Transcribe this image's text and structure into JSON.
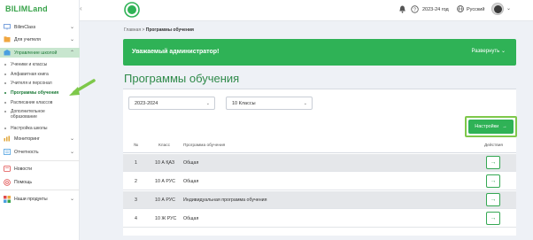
{
  "logo": "BILIMLand",
  "sidebar": {
    "items": [
      {
        "label": "BilimClass",
        "icon": "monitor-icon"
      },
      {
        "label": "Для учителя",
        "icon": "folder-icon"
      },
      {
        "label": "Управление школой",
        "icon": "school-icon"
      }
    ],
    "subitems": [
      {
        "label": "Ученики и классы"
      },
      {
        "label": "Алфавитная книга"
      },
      {
        "label": "Учителя и персонал"
      },
      {
        "label": "Программы обучения"
      },
      {
        "label": "Расписание классов"
      },
      {
        "label": "Дополнительное образование"
      },
      {
        "label": "Настройка школы"
      }
    ],
    "bottom_items": [
      {
        "label": "Мониторинг",
        "icon": "chart-icon"
      },
      {
        "label": "Отчетность",
        "icon": "report-icon"
      },
      {
        "label": "Новости",
        "icon": "news-icon"
      },
      {
        "label": "Помощь",
        "icon": "help-icon"
      },
      {
        "label": "Наши продукты",
        "icon": "products-icon"
      }
    ]
  },
  "topbar": {
    "year": "2023-24 год",
    "language": "Русский"
  },
  "breadcrumb": {
    "home": "Главная",
    "separator": ">",
    "current": "Программы обучения"
  },
  "banner": {
    "text": "Уважаемый администратор!",
    "expand_label": "Развернуть"
  },
  "page_title": "Программы обучения",
  "filters": {
    "year_value": "2023-2024",
    "class_value": "10 Классы"
  },
  "settings_button": "Настройки",
  "table": {
    "headers": {
      "num": "№",
      "class": "Класс",
      "program": "Программа обучения",
      "actions": "Действия"
    },
    "rows": [
      {
        "num": "1",
        "class": "10 А ҚАЗ",
        "program": "Общая"
      },
      {
        "num": "2",
        "class": "10 А РУС",
        "program": "Общая"
      },
      {
        "num": "3",
        "class": "10 А РУС",
        "program": "Индивидуальная программа обучения"
      },
      {
        "num": "4",
        "class": "10 Ж РУС",
        "program": "Общая"
      }
    ]
  },
  "colors": {
    "accent": "#2fb256",
    "active_bg": "#c8e6cf",
    "callout": "#7ec84a"
  }
}
